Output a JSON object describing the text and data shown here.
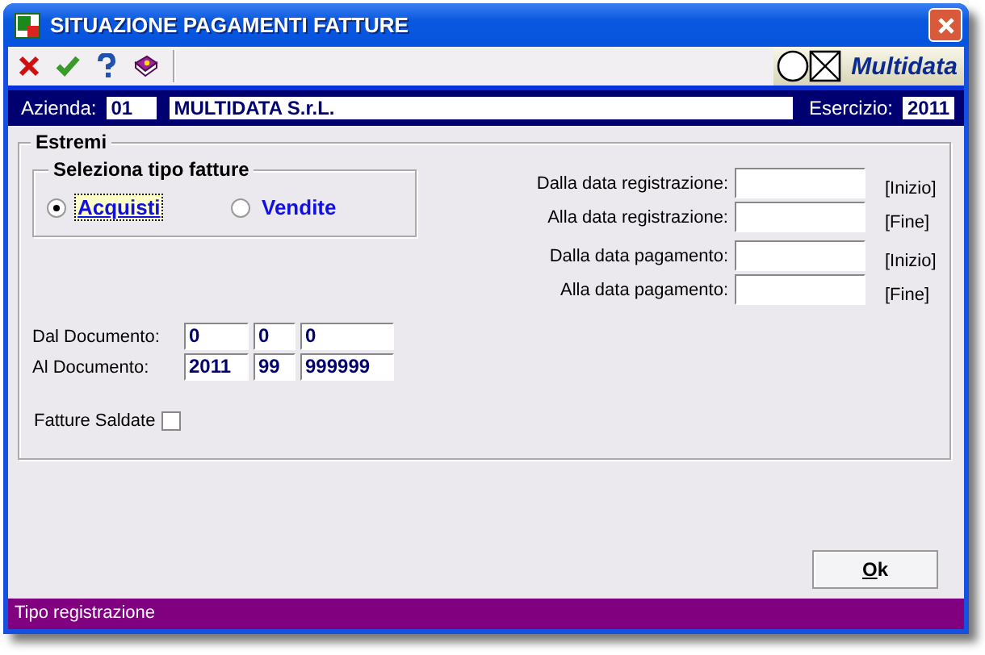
{
  "window": {
    "title": "SITUAZIONE PAGAMENTI FATTURE",
    "logo": "Multidata"
  },
  "toolbar": [
    {
      "kind": "cancel"
    },
    {
      "kind": "confirm"
    },
    {
      "kind": "help"
    },
    {
      "kind": "book"
    }
  ],
  "header": {
    "azienda_label": "Azienda:",
    "azienda_code": "01",
    "azienda_name": "MULTIDATA S.r.L.",
    "esercizio_label": "Esercizio:",
    "esercizio": "2011"
  },
  "group": {
    "title": "Estremi",
    "type_group": {
      "title": "Seleziona tipo fatture",
      "options": [
        {
          "label": "Acquisti",
          "selected": true
        },
        {
          "label": "Vendite",
          "selected": false
        }
      ]
    },
    "date_fields": [
      {
        "label": "Dalla data registrazione:",
        "hint": "[Inizio]"
      },
      {
        "label": "Alla data registrazione:",
        "hint": "[Fine]"
      },
      {
        "label": "Dalla data pagamento:",
        "hint": "[Inizio]"
      },
      {
        "label": "Alla data pagamento:",
        "hint": "[Fine]"
      }
    ],
    "documents": [
      {
        "label": "Dal Documento:",
        "values": [
          "0",
          "0",
          "0"
        ]
      },
      {
        "label": "Al Documento:",
        "values": [
          "2011",
          "99",
          "999999"
        ]
      }
    ],
    "paid": {
      "label": "Fatture Saldate",
      "checked": false
    }
  },
  "ok_button": "Ok",
  "status_bar": "Tipo registrazione"
}
